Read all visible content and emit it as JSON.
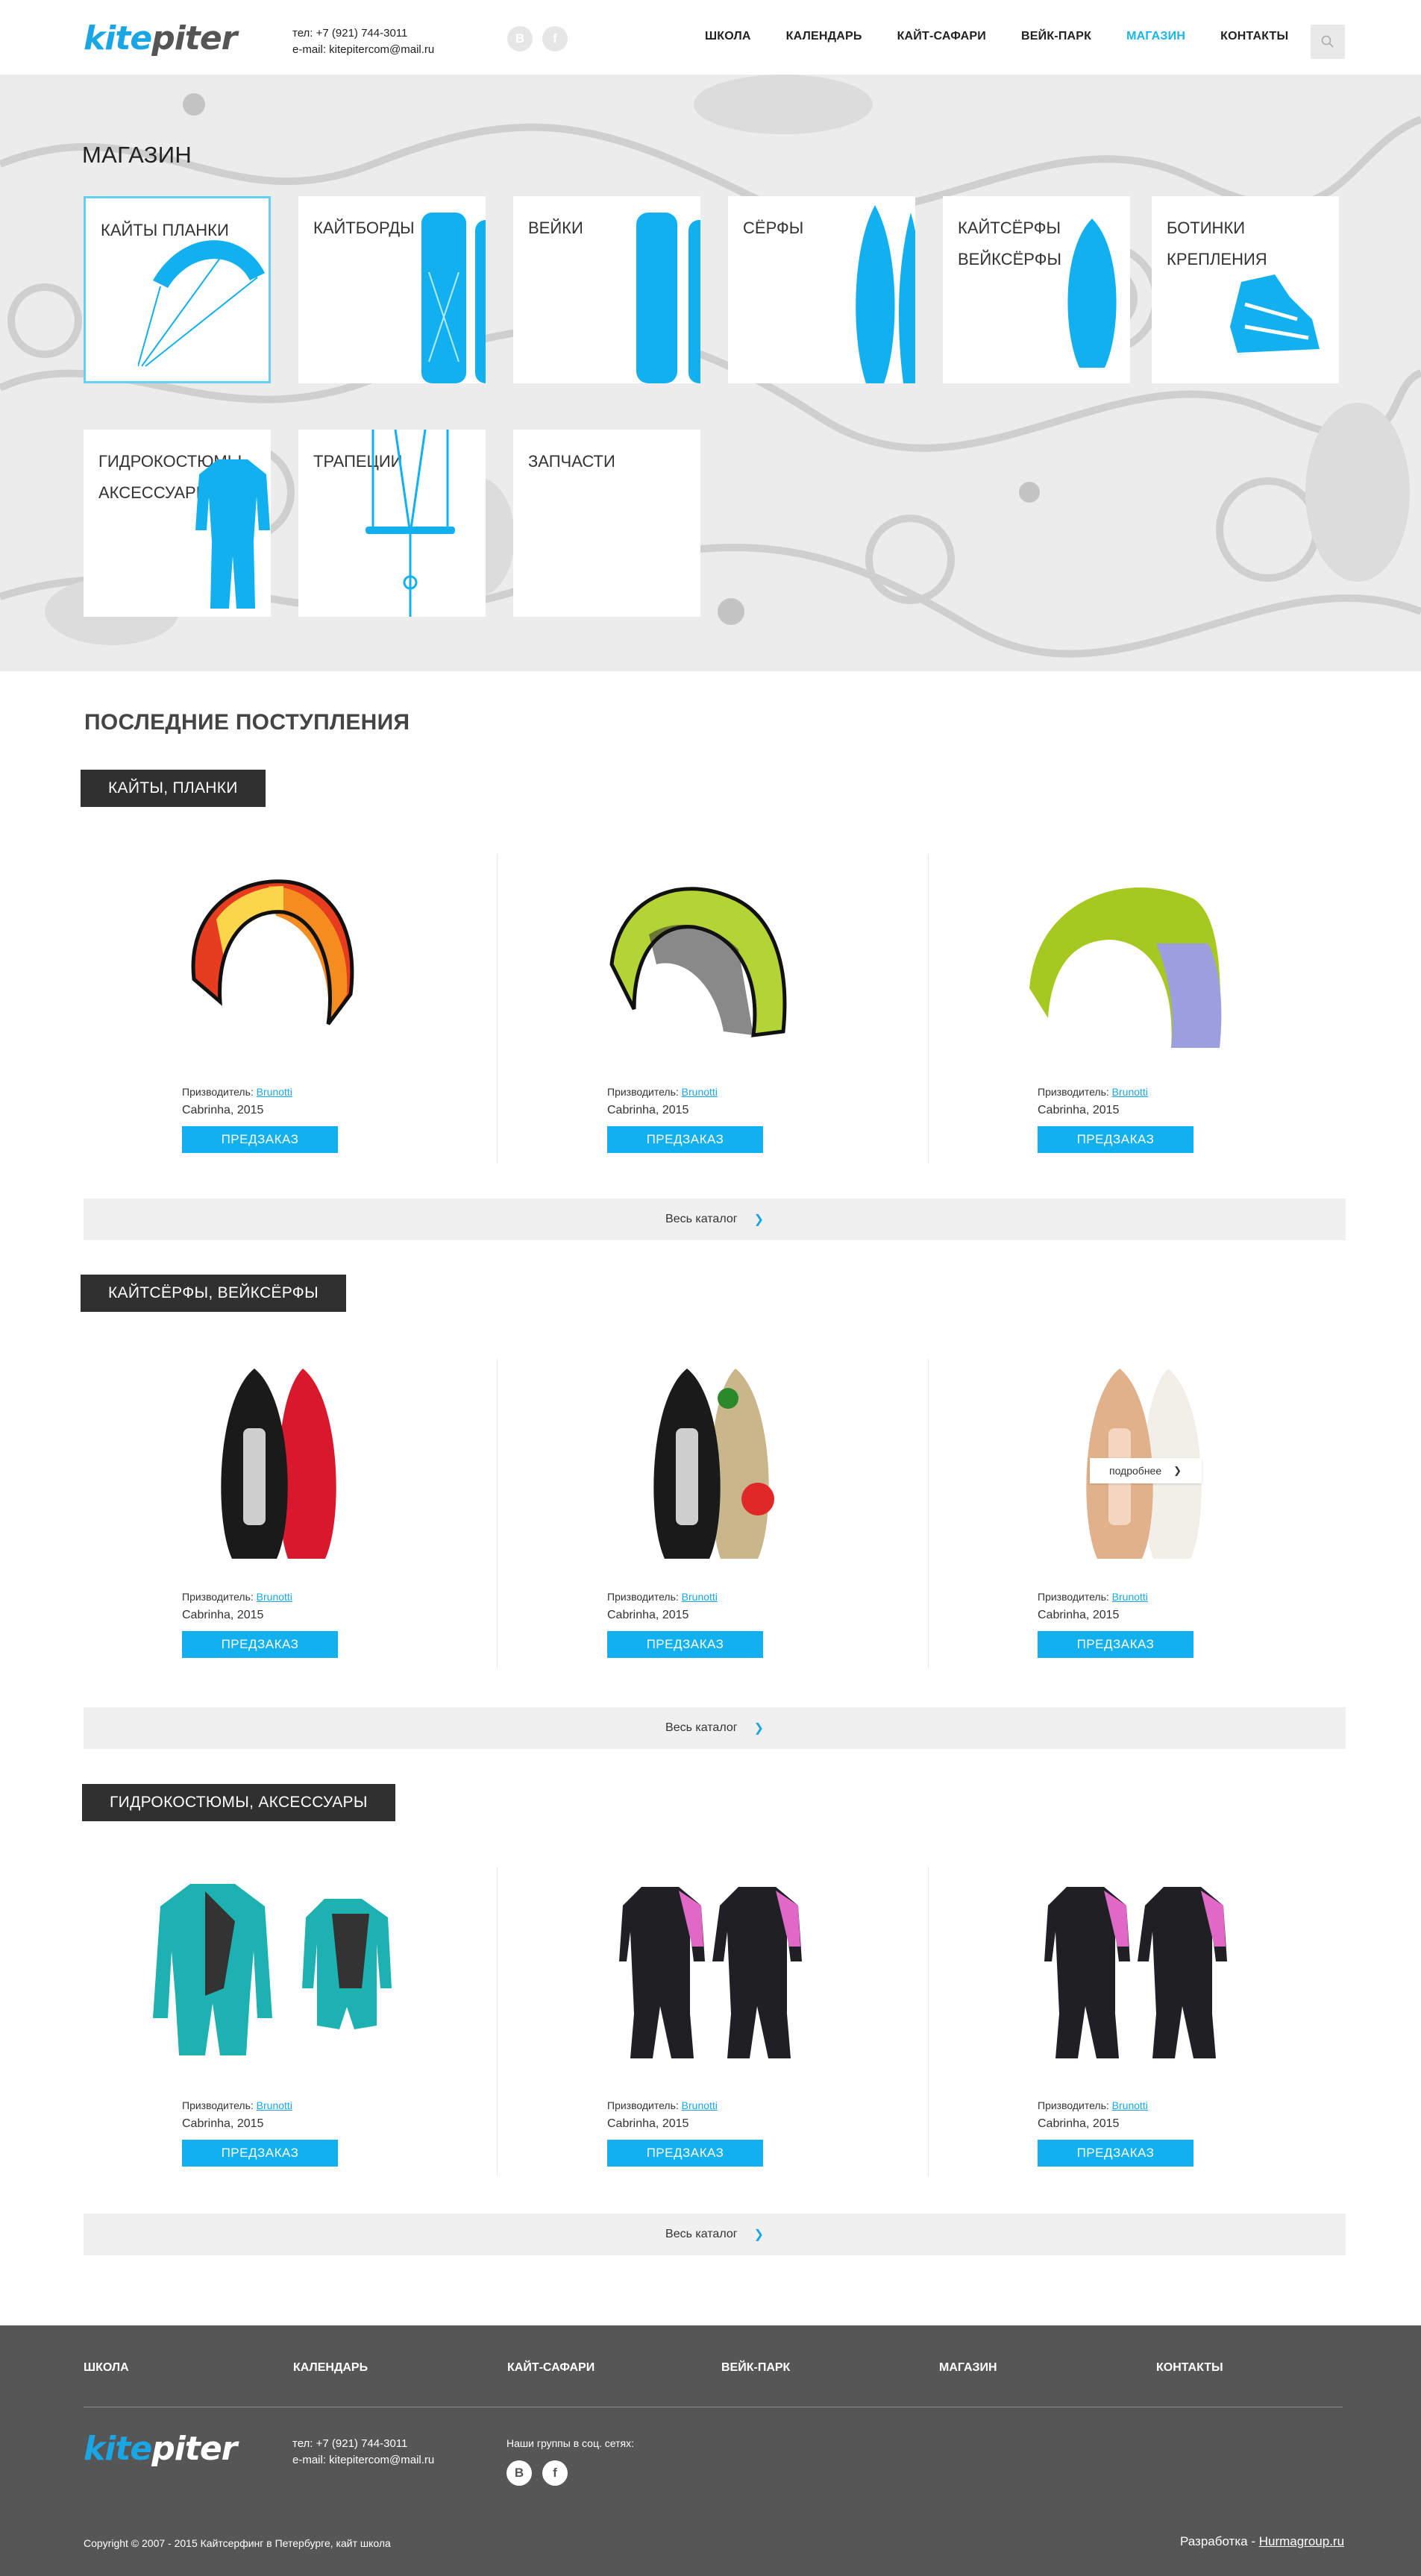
{
  "header": {
    "logo_k": "kite",
    "logo_p": "piter",
    "phone": "тел: +7 (921) 744-3011",
    "email": "e-mail: kitepitercom@mail.ru",
    "social": [
      "В",
      "f"
    ],
    "nav": [
      "ШКОЛА",
      "КАЛЕНДАРЬ",
      "КАЙТ-САФАРИ",
      "ВЕЙК-ПАРК",
      "МАГАЗИН",
      "КОНТАКТЫ"
    ],
    "active_nav": "МАГАЗИН",
    "search_icon": "search-icon"
  },
  "shop": {
    "title": "МАГАЗИН",
    "tiles": [
      {
        "label": "КАЙТЫ ПЛАНКИ",
        "icon": "kite-icon",
        "selected": true
      },
      {
        "label": "КАЙТБОРДЫ",
        "icon": "kiteboard-icon"
      },
      {
        "label": "ВЕЙКИ",
        "icon": "wakeboard-icon"
      },
      {
        "label": "СЁРФЫ",
        "icon": "surfboard-icon"
      },
      {
        "label": "КАЙТСЁРФЫ ВЕЙКСЁРФЫ",
        "icon": "kitesurf-icon"
      },
      {
        "label": "БОТИНКИ КРЕПЛЕНИЯ",
        "icon": "binding-icon"
      },
      {
        "label": "ГИДРОКОСТЮМЫ АКСЕССУАРЫ",
        "icon": "wetsuit-icon"
      },
      {
        "label": "ТРАПЕЦИИ",
        "icon": "control-bar-icon"
      },
      {
        "label": "ЗАПЧАСТИ",
        "icon": ""
      }
    ]
  },
  "latest": {
    "title": "ПОСЛЕДНИЕ ПОСТУПЛЕНИЯ",
    "maker_label": "Призводитель:",
    "order_label": "ПРЕДЗАКАЗ",
    "catalog_label": "Весь каталог",
    "tooltip": "подробнее",
    "categories": [
      {
        "name": "КАЙТЫ, ПЛАНКИ",
        "products": [
          {
            "maker": "Brunotti",
            "model": "Cabrinha, 2015"
          },
          {
            "maker": "Brunotti",
            "model": "Cabrinha, 2015"
          },
          {
            "maker": "Brunotti",
            "model": "Cabrinha, 2015"
          }
        ]
      },
      {
        "name": "КАЙТСЁРФЫ, ВЕЙКСЁРФЫ",
        "products": [
          {
            "maker": "Brunotti",
            "model": "Cabrinha, 2015"
          },
          {
            "maker": "Brunotti",
            "model": "Cabrinha, 2015"
          },
          {
            "maker": "Brunotti",
            "model": "Cabrinha, 2015"
          }
        ]
      },
      {
        "name": "ГИДРОКОСТЮМЫ, АКСЕССУАРЫ",
        "products": [
          {
            "maker": "Brunotti",
            "model": "Cabrinha, 2015"
          },
          {
            "maker": "Brunotti",
            "model": "Cabrinha, 2015"
          },
          {
            "maker": "Brunotti",
            "model": "Cabrinha, 2015"
          }
        ]
      }
    ]
  },
  "footer": {
    "nav": [
      "ШКОЛА",
      "КАЛЕНДАРЬ",
      "КАЙТ-САФАРИ",
      "ВЕЙК-ПАРК",
      "МАГАЗИН",
      "КОНТАКТЫ"
    ],
    "phone": "тел: +7 (921) 744-3011",
    "email": "e-mail: kitepitercom@mail.ru",
    "groups_label": "Наши группы в соц. сетях:",
    "social": [
      "В",
      "f"
    ],
    "copyright": "Copyright © 2007 - 2015 Кайтсерфинг в Петербурге, кайт школа",
    "dev_label": "Разработка - ",
    "dev_link": "Hurmagroup.ru"
  },
  "colors": {
    "accent": "#12b0ef",
    "dark": "#303030",
    "footer": "#565656"
  }
}
